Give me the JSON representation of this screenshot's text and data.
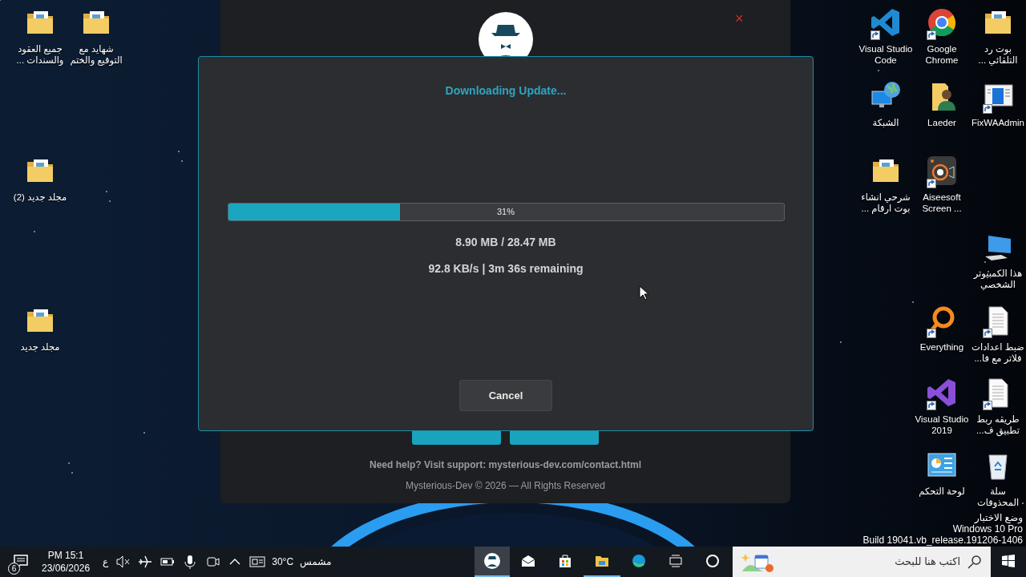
{
  "desktop": {
    "left_icons": [
      {
        "label": "شهايد مع التوقيع والختم",
        "kind": "folder",
        "shortcut": false
      },
      {
        "label": "جميع العقود والسندات ...",
        "kind": "folder",
        "shortcut": false
      },
      {
        "label": "مجلد جديد (2)",
        "kind": "folder",
        "shortcut": false
      },
      {
        "label": "مجلد جديد",
        "kind": "folder",
        "shortcut": false
      }
    ],
    "right_icons": [
      {
        "label": "بوت رد التلقائي ...",
        "kind": "folder",
        "shortcut": false
      },
      {
        "label": "Google Chrome",
        "kind": "chrome",
        "shortcut": true
      },
      {
        "label": "Visual Studio Code",
        "kind": "vscode",
        "shortcut": true
      },
      {
        "label": "FixWAAdmin",
        "kind": "app-window",
        "shortcut": true
      },
      {
        "label": "Laeder",
        "kind": "user-folder",
        "shortcut": false
      },
      {
        "label": "الشبكة",
        "kind": "network",
        "shortcut": false
      },
      {
        "label": "Aiseesoft Screen ...",
        "kind": "recorder",
        "shortcut": true
      },
      {
        "label": "شرحي انشاء بوت ارقام ...",
        "kind": "folder",
        "shortcut": false
      },
      {
        "label": "هذا الكمبيوتر الشخصي",
        "kind": "computer",
        "shortcut": false
      },
      {
        "label": "ضبط اعدادات فلاتر مع فا...",
        "kind": "document",
        "shortcut": true
      },
      {
        "label": "Everything",
        "kind": "everything",
        "shortcut": true
      },
      {
        "label": "طريقه ربط تطبيق ف...",
        "kind": "document",
        "shortcut": true
      },
      {
        "label": "Visual Studio 2019",
        "kind": "vs2019",
        "shortcut": true
      },
      {
        "label": "سلة المحذوفات",
        "kind": "recycle-bin",
        "shortcut": false
      },
      {
        "label": "لوحة التحكم",
        "kind": "control-panel",
        "shortcut": false
      }
    ],
    "test_mode": [
      "وضع الاختبار",
      "Windows 10 Pro",
      "Build 19041.vb_release.191206-1406"
    ]
  },
  "background_window": {
    "close": "×",
    "help": "Need help? Visit support: mysterious-dev.com/contact.html",
    "footer": "Mysterious-Dev © 2026 — All Rights Reserved"
  },
  "dialog": {
    "title": "Downloading Update...",
    "progress": {
      "level": 0.31,
      "label": "31%"
    },
    "size": "8.90 MB / 28.47 MB",
    "speed": "92.8 KB/s | 3m 36s remaining",
    "cancel": "Cancel"
  },
  "taskbar": {
    "notifications": "6",
    "time": "PM 15:1",
    "date": "23/06/2026",
    "language": "ع",
    "weather_temp": "30°C",
    "weather_text": "مشمس",
    "apps": [
      {
        "kind": "mysterious-dev",
        "selected": true,
        "running": true
      },
      {
        "kind": "mail",
        "selected": false,
        "running": false
      },
      {
        "kind": "store",
        "selected": false,
        "running": false
      },
      {
        "kind": "explorer",
        "selected": false,
        "running": true
      },
      {
        "kind": "edge",
        "selected": false,
        "running": false
      }
    ],
    "search_placeholder": "اكتب هنا للبحث"
  }
}
